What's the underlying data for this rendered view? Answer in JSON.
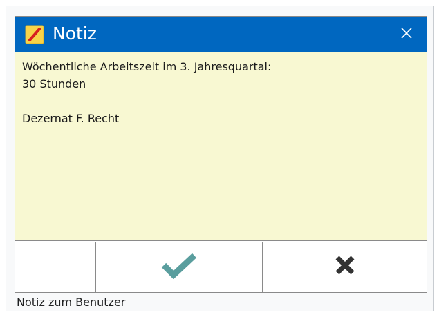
{
  "dialog": {
    "title": "Notiz",
    "title_icon": "pencil-note-icon",
    "close_icon": "close-icon",
    "note_text": "Wöchentliche Arbeitszeit im 3. Jahresquartal:\n30 Stunden\n\nDezernat F. Recht",
    "buttons": {
      "ok_icon": "checkmark-icon",
      "cancel_icon": "x-icon"
    }
  },
  "caption": "Notiz zum Benutzer",
  "colors": {
    "titlebar": "#0067c0",
    "note_background": "#f8f8d2",
    "checkmark": "#5a9e9e",
    "cancel_x": "#333333"
  }
}
